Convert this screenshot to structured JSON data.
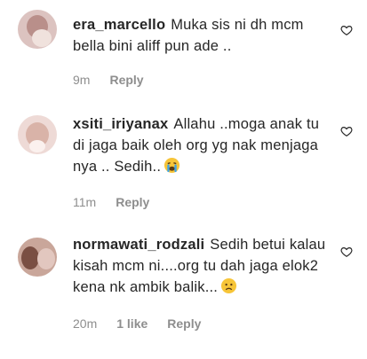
{
  "comments": [
    {
      "username": "era_marcello",
      "text": "Muka sis ni dh mcm bella bini aliff pun ade ..",
      "time": "9m",
      "likes": "",
      "reply_label": "Reply"
    },
    {
      "username": "xsiti_iriyanax",
      "text": "Allahu ..moga anak tu di jaga baik oleh org yg nak menjaga nya .. Sedih..",
      "emoji": "loudly-crying-face-emoji",
      "time": "11m",
      "likes": "",
      "reply_label": "Reply"
    },
    {
      "username": "normawati_rodzali",
      "text": "Sedih betui kalau kisah mcm ni....org tu dah jaga elok2 kena nk ambik balik...",
      "emoji": "sad-face-emoji",
      "time": "20m",
      "likes": "1 like",
      "reply_label": "Reply"
    }
  ],
  "icons": {
    "like": "heart-outline-icon"
  },
  "colors": {
    "text": "#262626",
    "meta": "#8e8e8e",
    "background": "#ffffff"
  }
}
